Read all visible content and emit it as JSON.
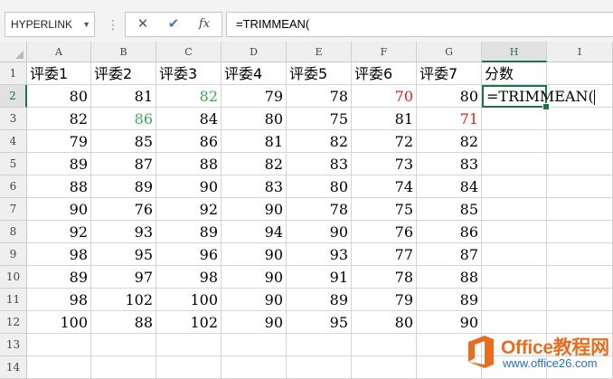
{
  "formula_bar": {
    "name_box": "HYPERLINK",
    "cancel_icon": "✕",
    "enter_icon": "✔",
    "fx_icon": "fx",
    "formula": "=TRIMMEAN("
  },
  "columns": [
    "A",
    "B",
    "C",
    "D",
    "E",
    "F",
    "G",
    "H",
    "I"
  ],
  "rows": [
    "1",
    "2",
    "3",
    "4",
    "5",
    "6",
    "7",
    "8",
    "9",
    "10",
    "11",
    "12",
    "13",
    "14"
  ],
  "headers": [
    "评委1",
    "评委2",
    "评委3",
    "评委4",
    "评委5",
    "评委6",
    "评委7",
    "分数"
  ],
  "data": [
    [
      "80",
      "81",
      "82",
      "79",
      "78",
      "70",
      "80"
    ],
    [
      "82",
      "86",
      "84",
      "80",
      "75",
      "81",
      "71"
    ],
    [
      "79",
      "85",
      "86",
      "81",
      "82",
      "72",
      "82"
    ],
    [
      "89",
      "87",
      "88",
      "82",
      "83",
      "73",
      "83"
    ],
    [
      "88",
      "89",
      "90",
      "83",
      "80",
      "74",
      "84"
    ],
    [
      "90",
      "76",
      "92",
      "90",
      "78",
      "75",
      "85"
    ],
    [
      "92",
      "93",
      "89",
      "94",
      "90",
      "76",
      "86"
    ],
    [
      "98",
      "95",
      "96",
      "90",
      "93",
      "77",
      "87"
    ],
    [
      "89",
      "97",
      "98",
      "90",
      "91",
      "78",
      "88"
    ],
    [
      "98",
      "102",
      "100",
      "90",
      "89",
      "79",
      "89"
    ],
    [
      "100",
      "88",
      "102",
      "90",
      "95",
      "80",
      "90"
    ]
  ],
  "active_cell": {
    "ref": "H2",
    "text": "=TRIMMEAN("
  },
  "highlighted_values": [
    {
      "row": 0,
      "col": 2,
      "color": "#3aa655"
    },
    {
      "row": 0,
      "col": 5,
      "color": "#e02020"
    },
    {
      "row": 1,
      "col": 1,
      "color": "#3aa655"
    },
    {
      "row": 1,
      "col": 6,
      "color": "#e02020"
    }
  ],
  "colors": {
    "accent": "#217346",
    "green_value": "#3aa655",
    "red_value": "#e02020"
  },
  "watermark": {
    "title": "Office教程网",
    "url": "www.office26.com"
  }
}
